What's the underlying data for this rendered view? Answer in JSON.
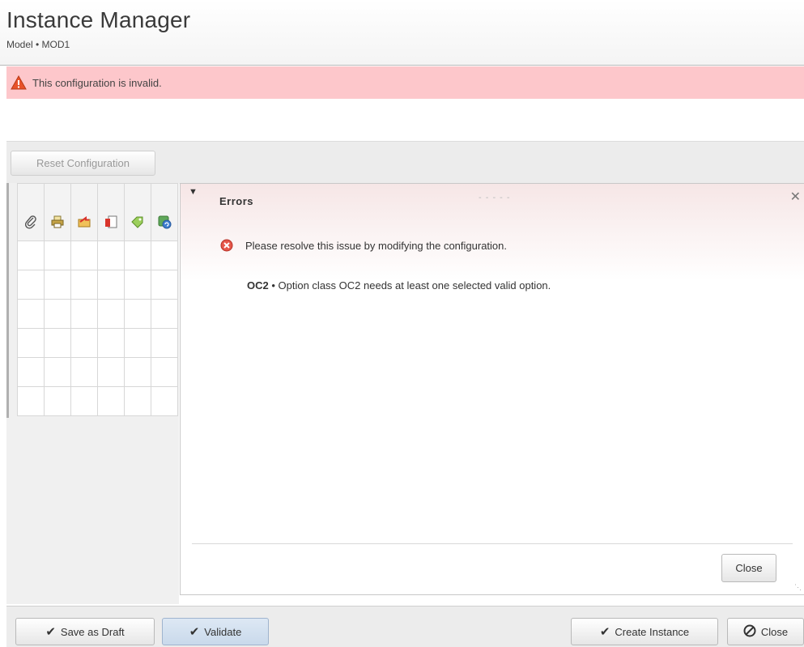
{
  "header": {
    "title": "Instance Manager",
    "subtitle": "Model • MOD1"
  },
  "alert": {
    "text": "This configuration is invalid.",
    "icon": "warning-icon",
    "background": "#fdc7cb"
  },
  "toolbar": {
    "reset_label": "Reset Configuration"
  },
  "grid": {
    "column_icons": [
      "paperclip-icon",
      "printer-icon",
      "folder-arrow-icon",
      "document-icon",
      "tag-icon",
      "refresh-icon"
    ],
    "row_count": 6
  },
  "errors_panel": {
    "title": "Errors",
    "message": "Please resolve this issue by modifying the configuration.",
    "issue_code": "OC2",
    "issue_separator": " • ",
    "issue_text": "Option class OC2 needs at least one selected valid option.",
    "close_label": "Close"
  },
  "footer": {
    "save_draft_label": "Save as Draft",
    "validate_label": "Validate",
    "create_instance_label": "Create Instance",
    "close_label": "Close"
  }
}
